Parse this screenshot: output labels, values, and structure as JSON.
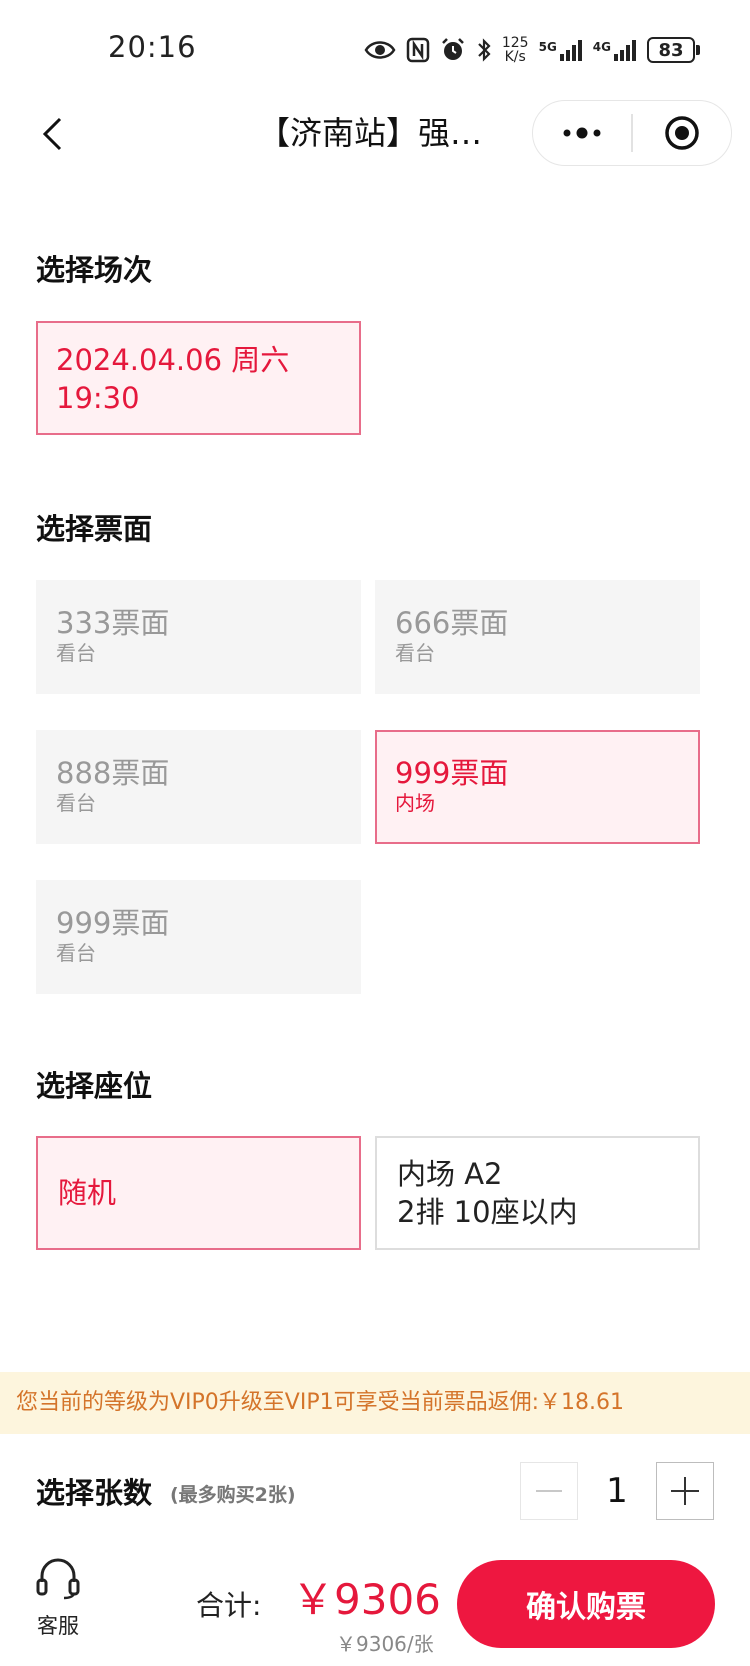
{
  "status_bar": {
    "time": "20:16",
    "net_speed_value": "125",
    "net_speed_unit": "K/s",
    "signal1_label": "5G",
    "signal2_label": "4G",
    "battery": "83"
  },
  "nav": {
    "title": "【济南站】强…"
  },
  "sections": {
    "session_title": "选择场次",
    "ticket_title": "选择票面",
    "seat_title": "选择座位"
  },
  "session": {
    "selected_label": "2024.04.06 周六 19:30"
  },
  "tickets": [
    {
      "price": "333票面",
      "area": "看台",
      "selected": false
    },
    {
      "price": "666票面",
      "area": "看台",
      "selected": false
    },
    {
      "price": "888票面",
      "area": "看台",
      "selected": false
    },
    {
      "price": "999票面",
      "area": "内场",
      "selected": true
    },
    {
      "price": "999票面",
      "area": "看台",
      "selected": false
    }
  ],
  "seats": {
    "random_label": "随机",
    "area_line1": "内场 A2",
    "area_line2": "2排 10座以内"
  },
  "vip_banner": "您当前的等级为VIP0升级至VIP1可享受当前票品返佣:￥18.61",
  "quantity": {
    "label": "选择张数",
    "limit": "(最多购买2张)",
    "value": "1"
  },
  "bottom": {
    "customer_service": "客服",
    "total_label": "合计:",
    "total_price": "￥9306",
    "unit_price": "￥9306/张",
    "confirm_label": "确认购票"
  },
  "colors": {
    "accent": "#e5183c",
    "button": "#ee1740",
    "selected_bg": "#fff1f3",
    "selected_border": "#e86d8a",
    "banner_bg": "#fdf5dd",
    "banner_text": "#d4742a"
  }
}
